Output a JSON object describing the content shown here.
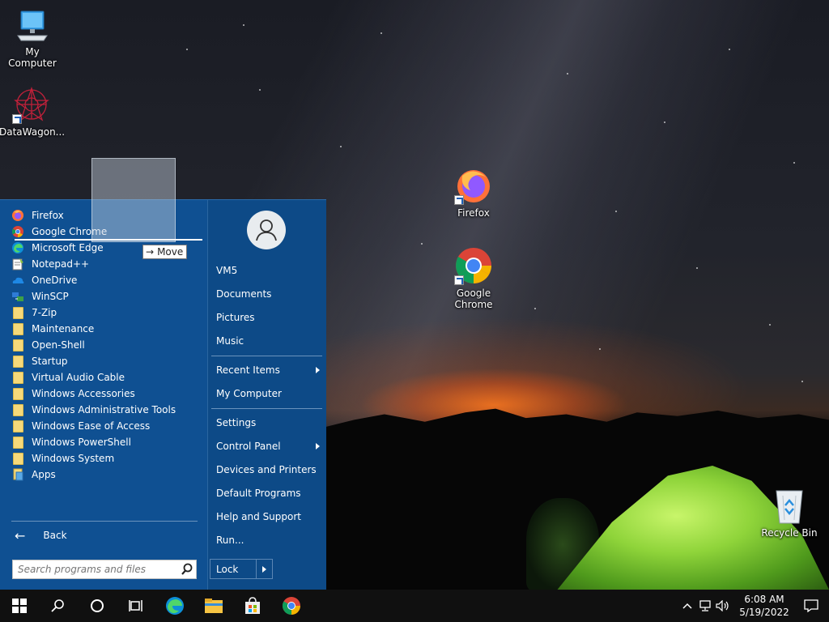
{
  "desktop": {
    "icons": [
      {
        "label": "My Computer",
        "icon": "computer-icon"
      },
      {
        "label": "DataWagon...",
        "icon": "datawagon-icon"
      },
      {
        "label": "Firefox",
        "icon": "firefox-icon"
      },
      {
        "label": "Google Chrome",
        "icon": "chrome-icon"
      },
      {
        "label": "Recycle Bin",
        "icon": "recycle-bin-icon"
      }
    ]
  },
  "start_menu": {
    "programs": [
      {
        "label": "Firefox",
        "icon": "firefox-icon"
      },
      {
        "label": "Google Chrome",
        "icon": "chrome-icon"
      },
      {
        "label": "Microsoft Edge",
        "icon": "edge-icon"
      },
      {
        "label": "Notepad++",
        "icon": "notepadpp-icon"
      },
      {
        "label": "OneDrive",
        "icon": "onedrive-icon"
      },
      {
        "label": "WinSCP",
        "icon": "winscp-icon"
      },
      {
        "label": "7-Zip",
        "icon": "folder-icon"
      },
      {
        "label": "Maintenance",
        "icon": "folder-icon"
      },
      {
        "label": "Open-Shell",
        "icon": "folder-icon"
      },
      {
        "label": "Startup",
        "icon": "folder-icon"
      },
      {
        "label": "Virtual Audio Cable",
        "icon": "folder-icon"
      },
      {
        "label": "Windows Accessories",
        "icon": "folder-icon"
      },
      {
        "label": "Windows Administrative Tools",
        "icon": "folder-icon"
      },
      {
        "label": "Windows Ease of Access",
        "icon": "folder-icon"
      },
      {
        "label": "Windows PowerShell",
        "icon": "folder-icon"
      },
      {
        "label": "Windows System",
        "icon": "folder-icon"
      },
      {
        "label": "Apps",
        "icon": "apps-icon"
      }
    ],
    "back_label": "Back",
    "search_placeholder": "Search programs and files",
    "drag_tooltip": "Move",
    "right": {
      "user": "VM5",
      "documents": "Documents",
      "pictures": "Pictures",
      "music": "Music",
      "recent_items": "Recent Items",
      "my_computer": "My Computer",
      "settings": "Settings",
      "control_panel": "Control Panel",
      "devices_printers": "Devices and Printers",
      "default_programs": "Default Programs",
      "help_support": "Help and Support",
      "run": "Run...",
      "lock": "Lock"
    }
  },
  "taskbar": {
    "time": "6:08 AM",
    "date": "5/19/2022"
  },
  "colors": {
    "start_menu_bg": "#0f5092",
    "taskbar_bg": "#101010",
    "accent": "#1d5fb8"
  }
}
